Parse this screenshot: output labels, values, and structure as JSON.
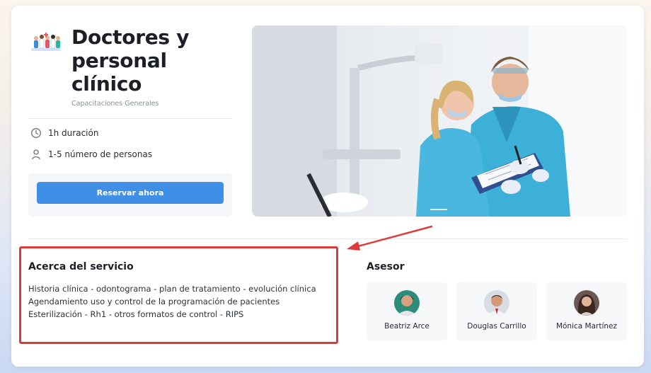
{
  "service": {
    "title_lines": [
      "Doctores y",
      "personal",
      "clínico"
    ],
    "category": "Capacitaciones Generales",
    "logo_icon": "medical-staff-illustration",
    "duration": "1h duración",
    "group_size": "1-5 número de personas",
    "book_label": "Reservar ahora",
    "accent_color": "#3f8fe6"
  },
  "hero": {
    "image": "dentists-with-clipboard-photo"
  },
  "about": {
    "title": "Acerca del servicio",
    "lines": [
      "Historia clínica - odontograma - plan de tratamiento - evolución clínica",
      "Agendamiento uso y control de la programación de pacientes",
      "Esterilización - Rh1 - otros formatos de control - RIPS"
    ],
    "highlight_color": "#dd3b3b"
  },
  "advisors": {
    "title": "Asesor",
    "people": [
      {
        "name": "Beatriz Arce"
      },
      {
        "name": "Douglas Carrillo"
      },
      {
        "name": "Mónica Martínez"
      }
    ]
  }
}
